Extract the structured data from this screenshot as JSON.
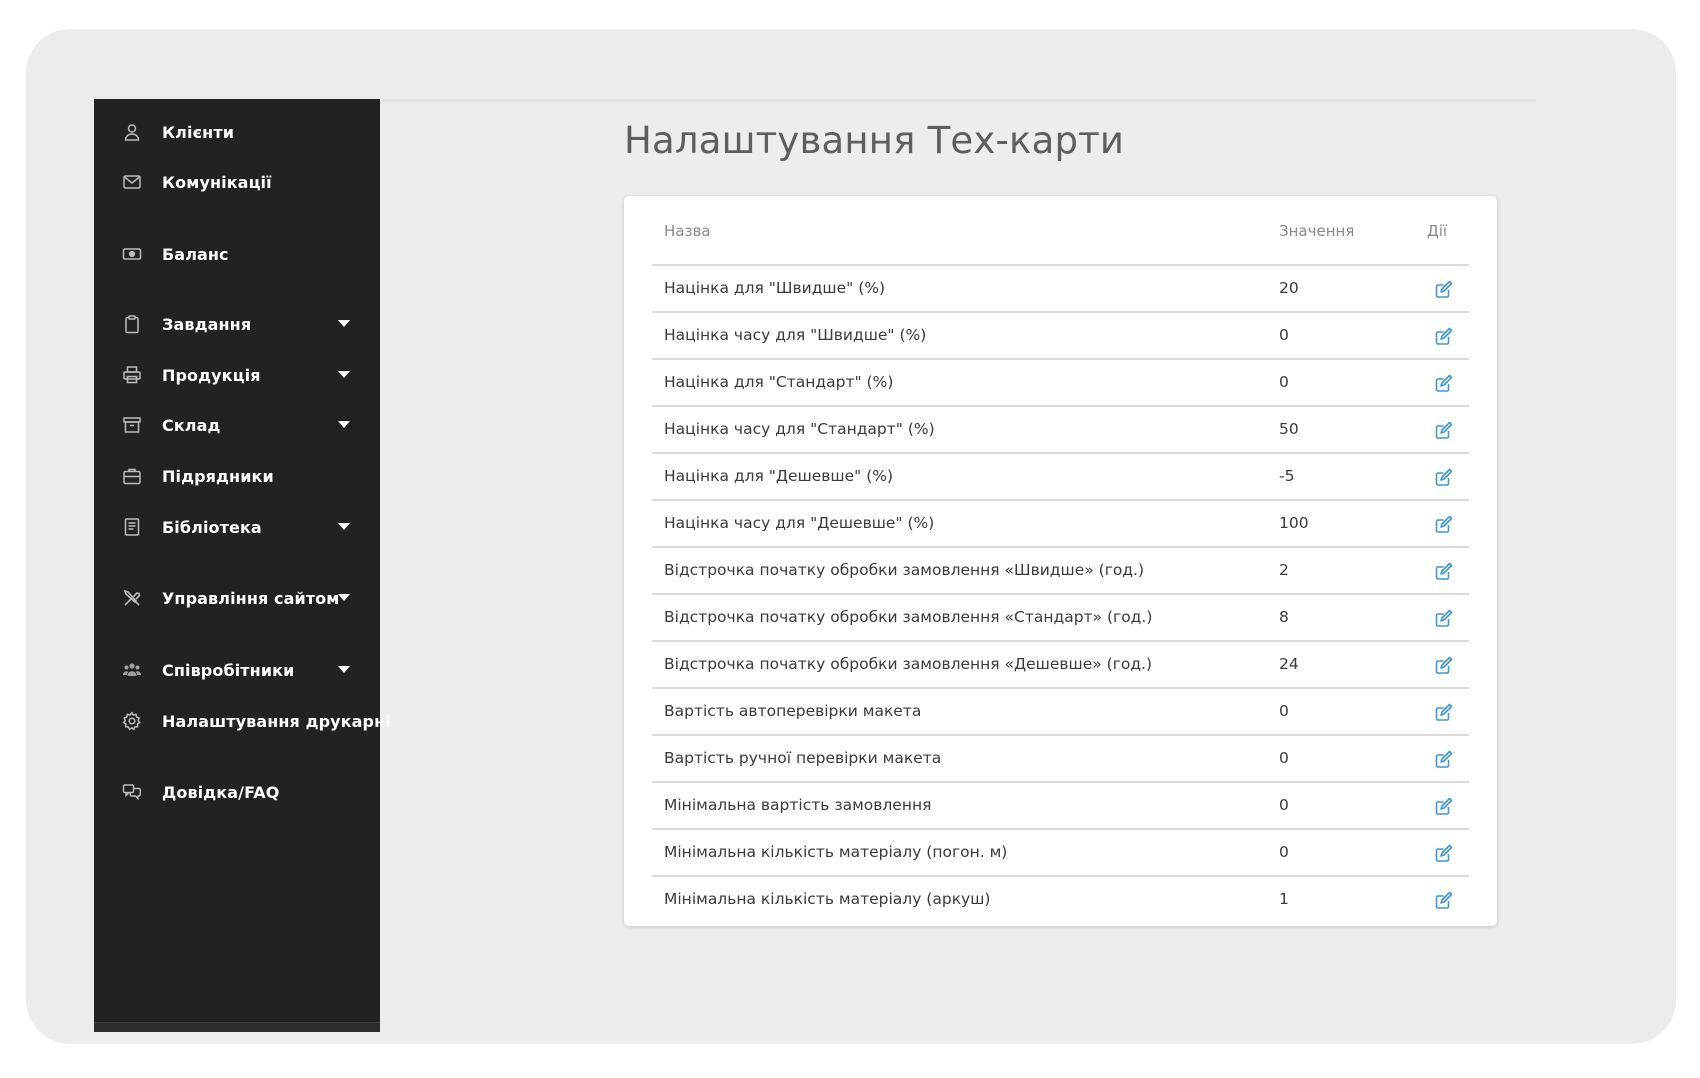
{
  "colors": {
    "sidebar_bg": "#222222",
    "content_bg": "#ededed",
    "accent_edit": "#3d97d8",
    "title_text": "#5e5e5e"
  },
  "sidebar": {
    "items": [
      {
        "label": "Клієнти",
        "icon": "user-icon",
        "has_caret": false
      },
      {
        "label": "Комунікації",
        "icon": "envelope-icon",
        "has_caret": false
      },
      {
        "label": "Баланс",
        "icon": "money-icon",
        "has_caret": false
      },
      {
        "label": "Завдання",
        "icon": "clipboard-icon",
        "has_caret": true
      },
      {
        "label": "Продукція",
        "icon": "printer-icon",
        "has_caret": true
      },
      {
        "label": "Склад",
        "icon": "archive-icon",
        "has_caret": true
      },
      {
        "label": "Підрядники",
        "icon": "briefcase-icon",
        "has_caret": false
      },
      {
        "label": "Бібліотека",
        "icon": "book-icon",
        "has_caret": true
      },
      {
        "label": "Управління сайтом",
        "icon": "tools-icon",
        "has_caret": true
      },
      {
        "label": "Співробітники",
        "icon": "users-icon",
        "has_caret": true
      },
      {
        "label": "Налаштування друкарні",
        "icon": "gear-icon",
        "has_caret": false
      },
      {
        "label": "Довідка/FAQ",
        "icon": "chat-icon",
        "has_caret": false
      }
    ]
  },
  "main": {
    "title": "Налаштування Тех-карти",
    "table": {
      "columns": {
        "name": "Назва",
        "value": "Значення",
        "actions": "Дії"
      },
      "rows": [
        {
          "name": "Націнка для \"Швидше\" (%)",
          "value": "20"
        },
        {
          "name": "Націнка часу для \"Швидше\" (%)",
          "value": "0"
        },
        {
          "name": "Націнка для \"Стандарт\" (%)",
          "value": "0"
        },
        {
          "name": "Націнка часу для \"Стандарт\" (%)",
          "value": "50"
        },
        {
          "name": "Націнка для \"Дешевше\" (%)",
          "value": "-5"
        },
        {
          "name": "Націнка часу для \"Дешевше\" (%)",
          "value": "100"
        },
        {
          "name": "Відстрочка початку обробки замовлення «Швидше» (год.)",
          "value": "2"
        },
        {
          "name": "Відстрочка початку обробки замовлення «Стандарт» (год.)",
          "value": "8"
        },
        {
          "name": "Відстрочка початку обробки замовлення «Дешевше» (год.)",
          "value": "24"
        },
        {
          "name": "Вартість автоперевірки макета",
          "value": "0"
        },
        {
          "name": "Вартість ручної перевірки макета",
          "value": "0"
        },
        {
          "name": "Мінімальна вартість замовлення",
          "value": "0"
        },
        {
          "name": "Мінімальна кількість матеріалу (погон. м)",
          "value": "0"
        },
        {
          "name": "Мінімальна кількість матеріалу (аркуш)",
          "value": "1"
        }
      ]
    }
  }
}
